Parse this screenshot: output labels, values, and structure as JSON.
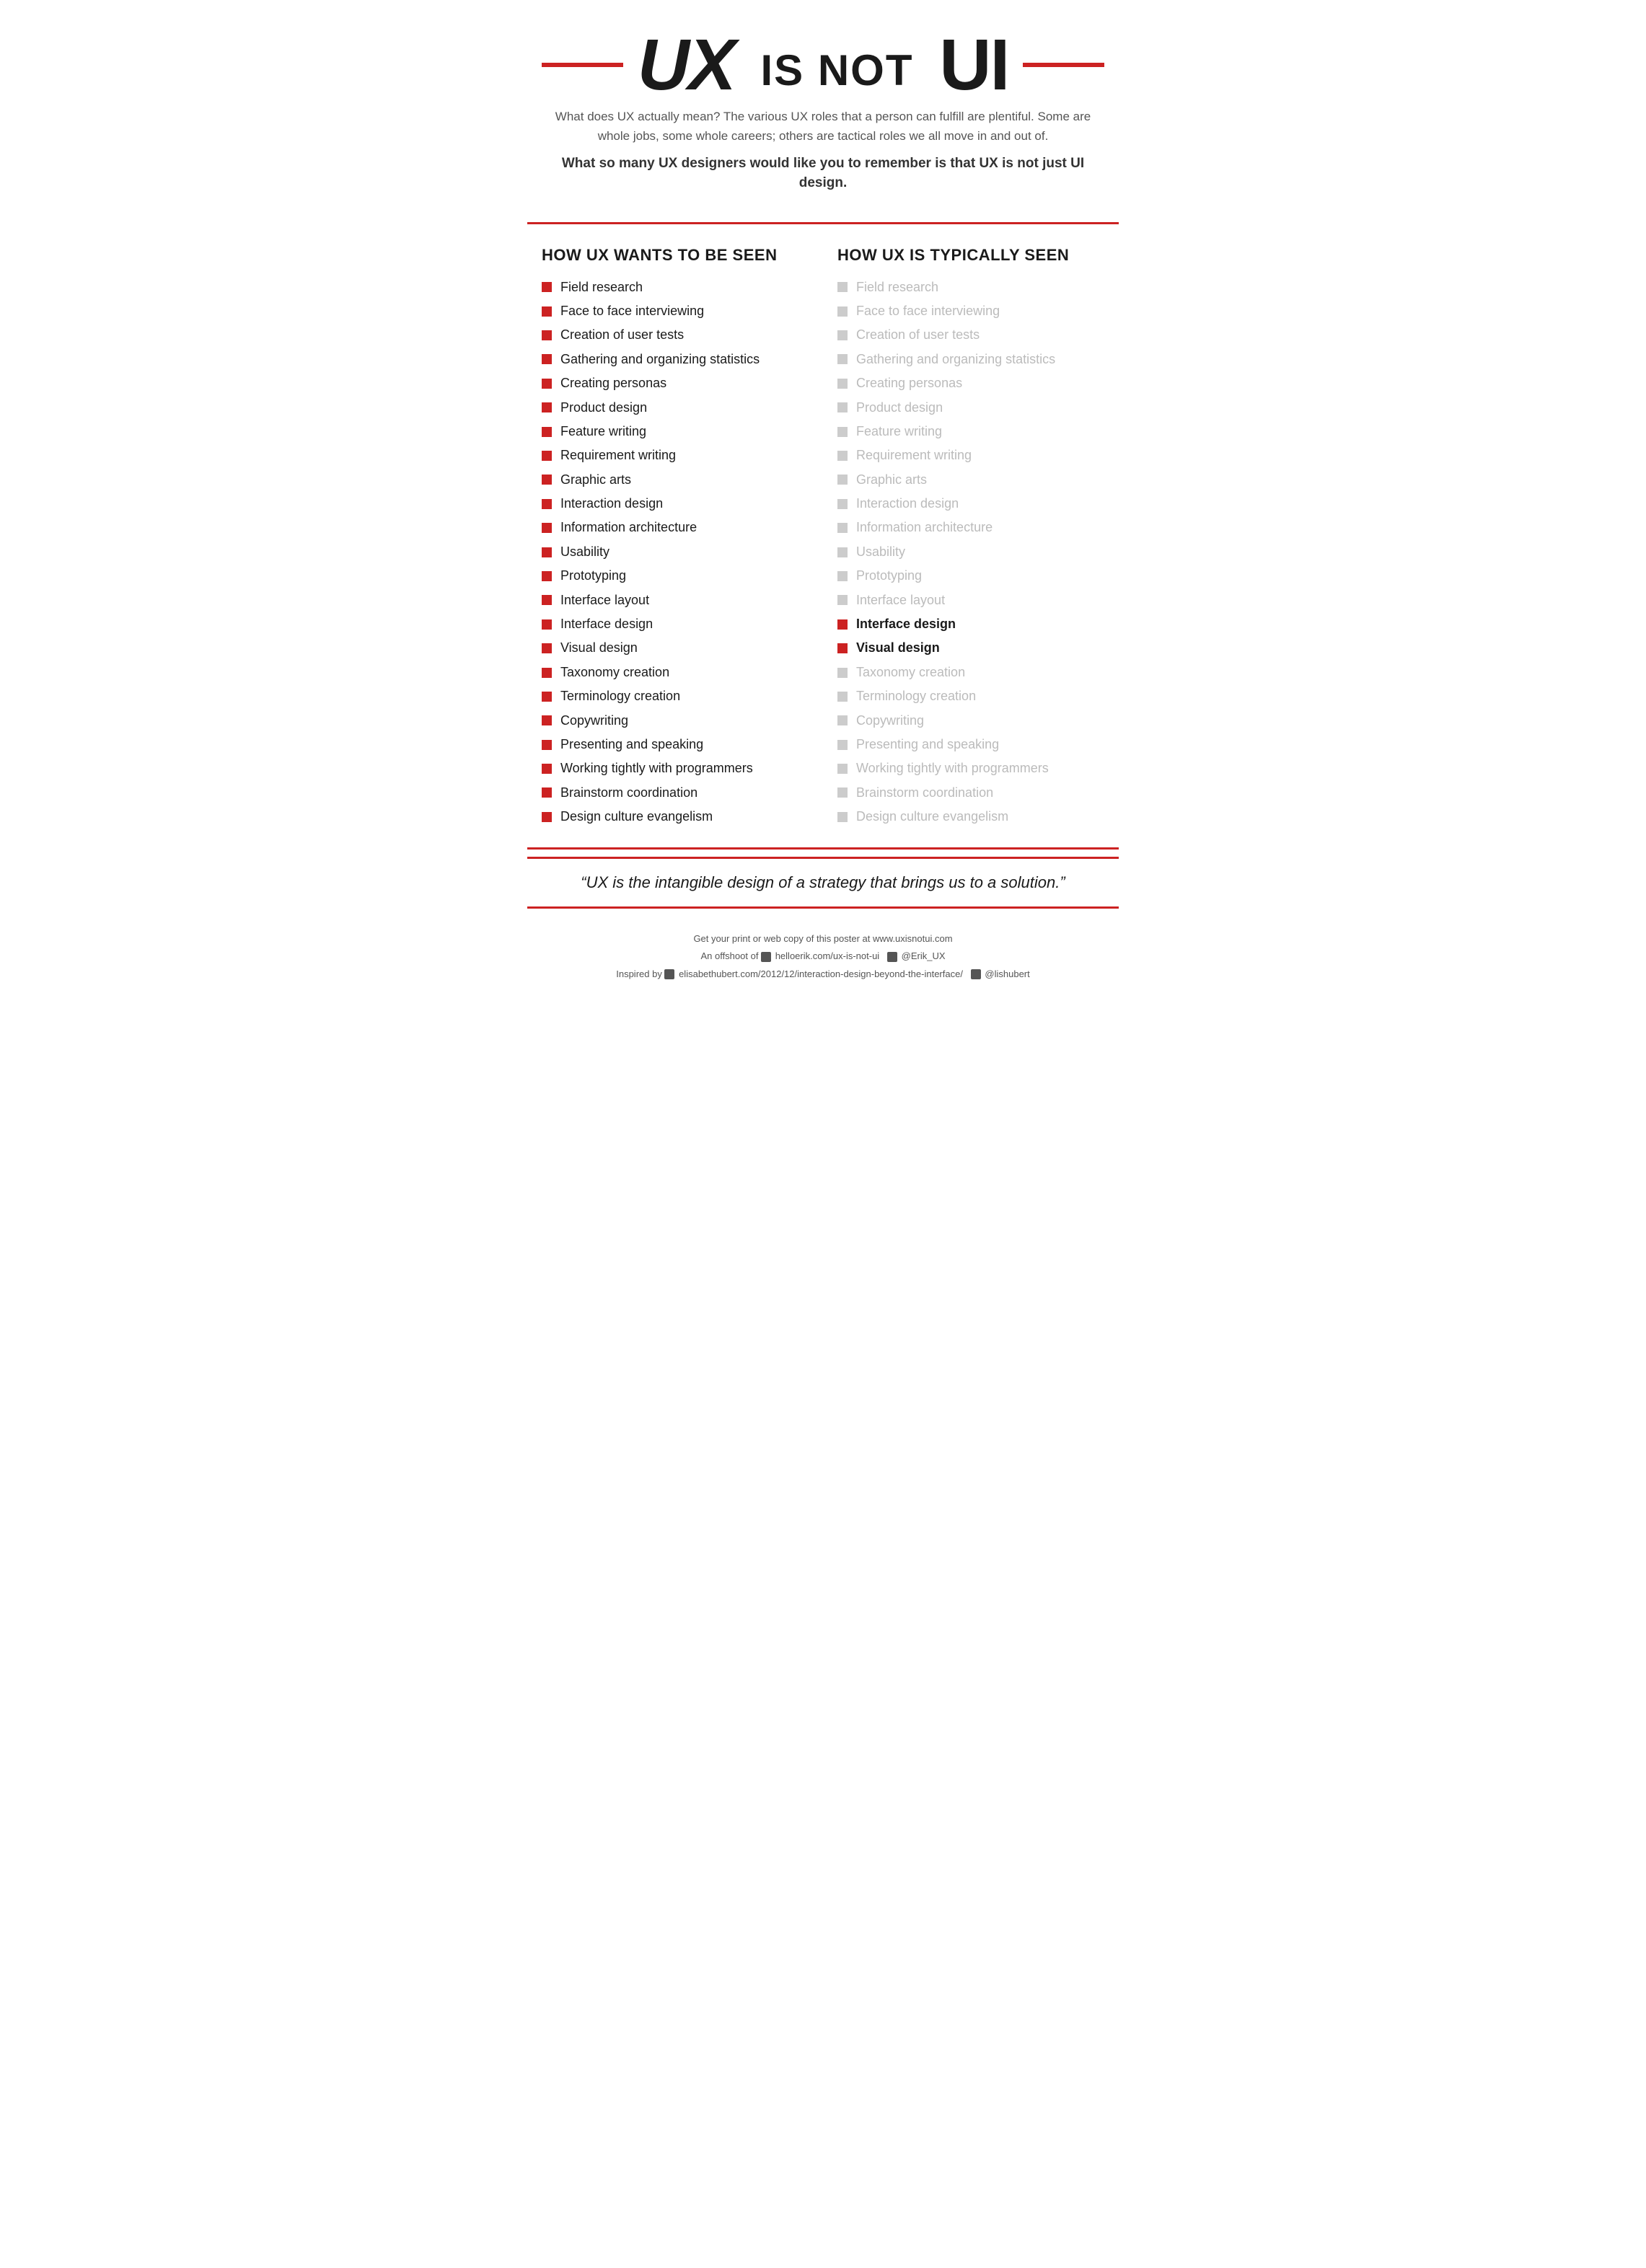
{
  "header": {
    "title_ux": "UX",
    "title_middle": "IS NOT",
    "title_ui": "UI",
    "subtitle_desc": "What does UX actually mean? The various UX roles that a person can fulfill are plentiful. Some are whole jobs, some whole careers; others are tactical roles we all move in and out of.",
    "subtitle_bold": "What so many UX designers would like you to remember is that UX is not just UI design."
  },
  "left_column": {
    "heading": "HOW UX WANTS TO BE SEEN",
    "items": [
      "Field research",
      "Face to face interviewing",
      "Creation of user tests",
      "Gathering and organizing statistics",
      "Creating personas",
      "Product design",
      "Feature writing",
      "Requirement writing",
      "Graphic arts",
      "Interaction design",
      "Information architecture",
      "Usability",
      "Prototyping",
      "Interface layout",
      "Interface design",
      "Visual design",
      "Taxonomy creation",
      "Terminology creation",
      "Copywriting",
      "Presenting and speaking",
      "Working tightly with programmers",
      "Brainstorm coordination",
      "Design culture evangelism"
    ]
  },
  "right_column": {
    "heading": "HOW UX IS TYPICALLY SEEN",
    "items": [
      {
        "text": "Field research",
        "highlight": false
      },
      {
        "text": "Face to face interviewing",
        "highlight": false
      },
      {
        "text": "Creation of user tests",
        "highlight": false
      },
      {
        "text": "Gathering and organizing statistics",
        "highlight": false
      },
      {
        "text": "Creating personas",
        "highlight": false
      },
      {
        "text": "Product design",
        "highlight": false
      },
      {
        "text": "Feature writing",
        "highlight": false
      },
      {
        "text": "Requirement writing",
        "highlight": false
      },
      {
        "text": "Graphic arts",
        "highlight": false
      },
      {
        "text": "Interaction design",
        "highlight": false
      },
      {
        "text": "Information architecture",
        "highlight": false
      },
      {
        "text": "Usability",
        "highlight": false
      },
      {
        "text": "Prototyping",
        "highlight": false
      },
      {
        "text": "Interface layout",
        "highlight": false
      },
      {
        "text": "Interface design",
        "highlight": true
      },
      {
        "text": "Visual design",
        "highlight": true
      },
      {
        "text": "Taxonomy creation",
        "highlight": false
      },
      {
        "text": "Terminology creation",
        "highlight": false
      },
      {
        "text": "Copywriting",
        "highlight": false
      },
      {
        "text": "Presenting and speaking",
        "highlight": false
      },
      {
        "text": "Working tightly with programmers",
        "highlight": false
      },
      {
        "text": "Brainstorm coordination",
        "highlight": false
      },
      {
        "text": "Design culture evangelism",
        "highlight": false
      }
    ]
  },
  "quote": {
    "text": "“UX is the intangible design of a strategy that brings us to a solution.”"
  },
  "footer": {
    "line1": "Get your print or web copy of this poster at www.uxisnotui.com",
    "line2_prefix": "An offshoot of",
    "line2_link": "helloerik.com/ux-is-not-ui",
    "line2_twitter": "@Erik_UX",
    "line3_prefix": "Inspired by",
    "line3_link": "elisabethubert.com/2012/12/interaction-design-beyond-the-interface/",
    "line3_twitter": "@lishubert"
  }
}
